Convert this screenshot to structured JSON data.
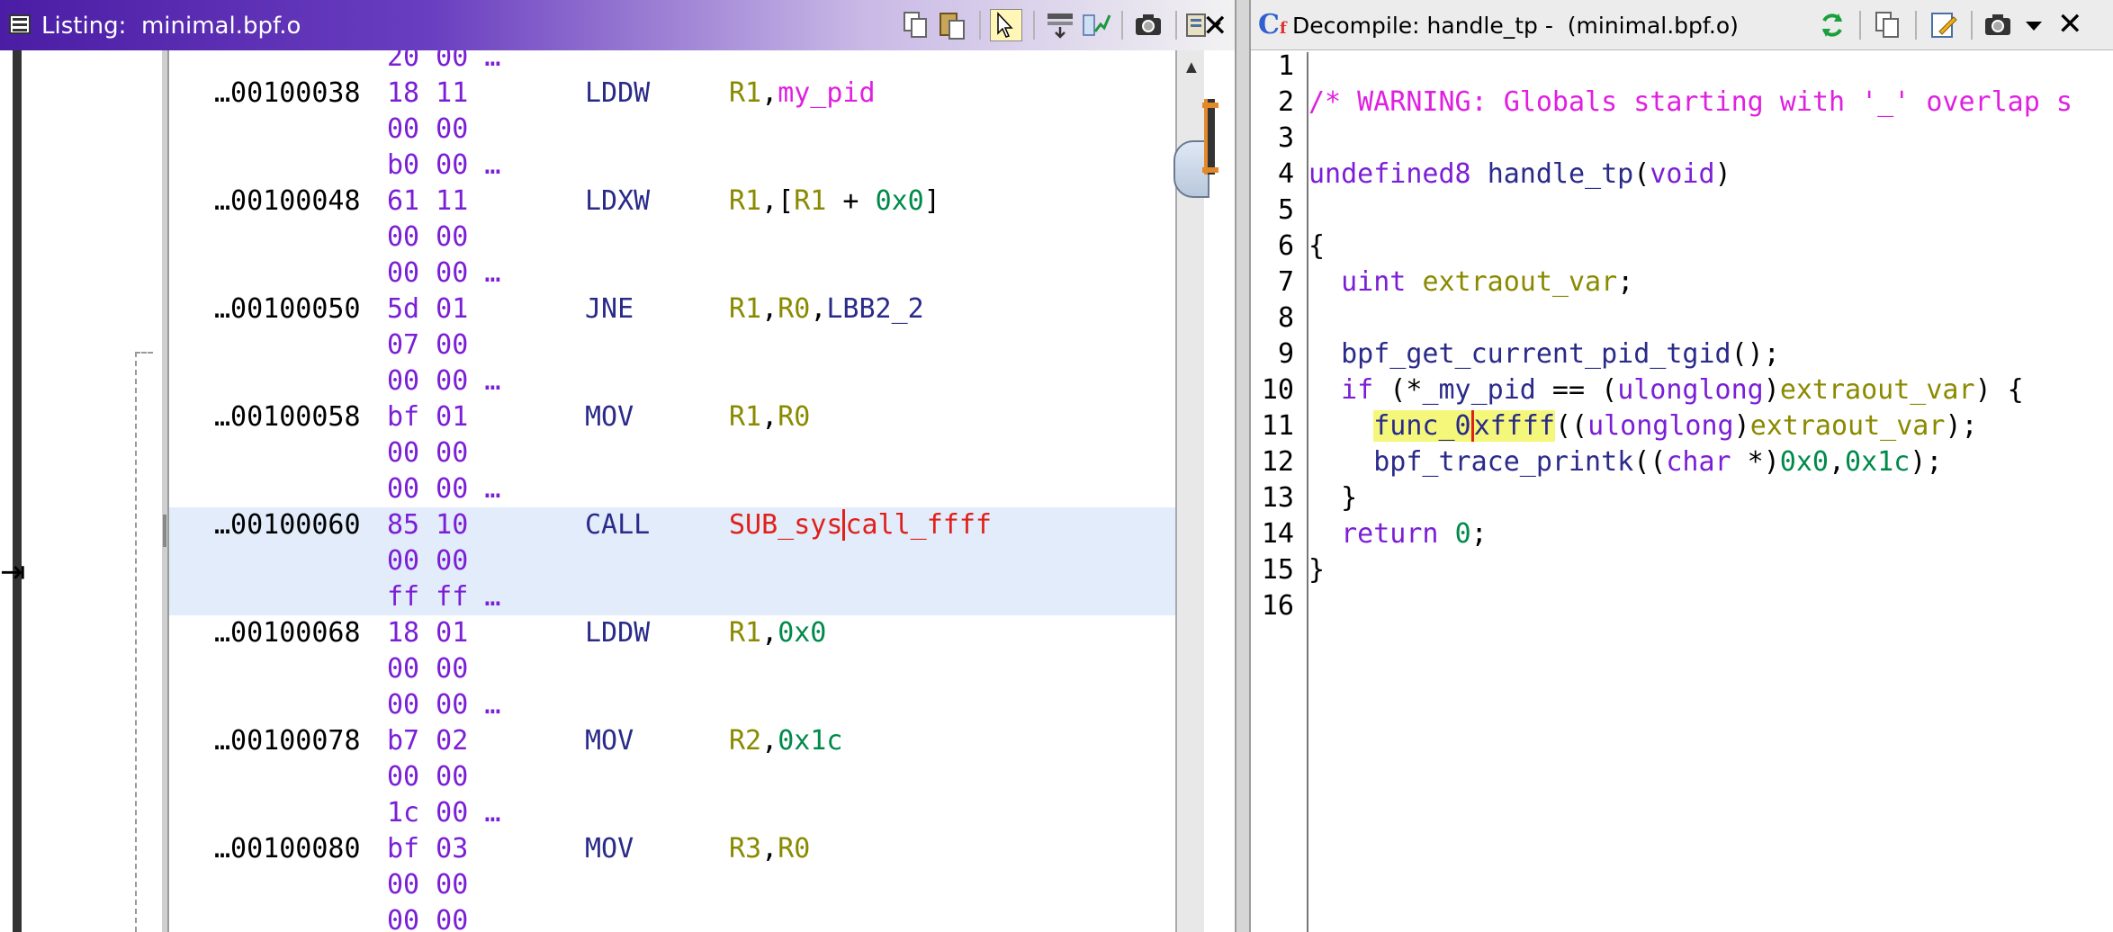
{
  "listing": {
    "title": "Listing:  minimal.bpf.o",
    "rows": [
      {
        "addr": "",
        "bytes": "20 00 …",
        "mnem": "",
        "ops": []
      },
      {
        "addr": "…00100038",
        "bytes": "18 11",
        "mnem": "LDDW",
        "ops": [
          [
            "r",
            "R1"
          ],
          [
            "pun",
            ","
          ],
          [
            "sym",
            "my_pid"
          ]
        ]
      },
      {
        "addr": "",
        "bytes": "00 00",
        "mnem": "",
        "ops": []
      },
      {
        "addr": "",
        "bytes": "b0 00 …",
        "mnem": "",
        "ops": []
      },
      {
        "addr": "…00100048",
        "bytes": "61 11",
        "mnem": "LDXW",
        "ops": [
          [
            "r",
            "R1"
          ],
          [
            "pun",
            ",["
          ],
          [
            "r",
            "R1"
          ],
          [
            "pun",
            " + "
          ],
          [
            "num",
            "0x0"
          ],
          [
            "pun",
            "]"
          ]
        ]
      },
      {
        "addr": "",
        "bytes": "00 00",
        "mnem": "",
        "ops": []
      },
      {
        "addr": "",
        "bytes": "00 00 …",
        "mnem": "",
        "ops": []
      },
      {
        "addr": "…00100050",
        "bytes": "5d 01",
        "mnem": "JNE",
        "ops": [
          [
            "r",
            "R1"
          ],
          [
            "pun",
            ","
          ],
          [
            "r",
            "R0"
          ],
          [
            "pun",
            ","
          ],
          [
            "lbl",
            "LBB2_2"
          ]
        ]
      },
      {
        "addr": "",
        "bytes": "07 00",
        "mnem": "",
        "ops": []
      },
      {
        "addr": "",
        "bytes": "00 00 …",
        "mnem": "",
        "ops": []
      },
      {
        "addr": "…00100058",
        "bytes": "bf 01",
        "mnem": "MOV",
        "ops": [
          [
            "r",
            "R1"
          ],
          [
            "pun",
            ","
          ],
          [
            "r",
            "R0"
          ]
        ]
      },
      {
        "addr": "",
        "bytes": "00 00",
        "mnem": "",
        "ops": []
      },
      {
        "addr": "",
        "bytes": "00 00 …",
        "mnem": "",
        "ops": []
      },
      {
        "addr": "…00100060",
        "bytes": "85 10",
        "mnem": "CALL",
        "ops": [
          [
            "fn",
            "SUB_sys"
          ],
          [
            "fncur",
            "call_ffff"
          ]
        ],
        "highlight": true
      },
      {
        "addr": "",
        "bytes": "00 00",
        "mnem": "",
        "ops": [],
        "highlight": true
      },
      {
        "addr": "",
        "bytes": "ff ff …",
        "mnem": "",
        "ops": [],
        "highlight": true
      },
      {
        "addr": "…00100068",
        "bytes": "18 01",
        "mnem": "LDDW",
        "ops": [
          [
            "r",
            "R1"
          ],
          [
            "pun",
            ","
          ],
          [
            "num",
            "0x0"
          ]
        ]
      },
      {
        "addr": "",
        "bytes": "00 00",
        "mnem": "",
        "ops": []
      },
      {
        "addr": "",
        "bytes": "00 00 …",
        "mnem": "",
        "ops": []
      },
      {
        "addr": "…00100078",
        "bytes": "b7 02",
        "mnem": "MOV",
        "ops": [
          [
            "r",
            "R2"
          ],
          [
            "pun",
            ","
          ],
          [
            "num",
            "0x1c"
          ]
        ]
      },
      {
        "addr": "",
        "bytes": "00 00",
        "mnem": "",
        "ops": []
      },
      {
        "addr": "",
        "bytes": "1c 00 …",
        "mnem": "",
        "ops": []
      },
      {
        "addr": "…00100080",
        "bytes": "bf 03",
        "mnem": "MOV",
        "ops": [
          [
            "r",
            "R3"
          ],
          [
            "pun",
            ","
          ],
          [
            "r",
            "R0"
          ]
        ]
      },
      {
        "addr": "",
        "bytes": "00 00",
        "mnem": "",
        "ops": []
      },
      {
        "addr": "",
        "bytes": "00 00",
        "mnem": "",
        "ops": []
      }
    ]
  },
  "decompile": {
    "title": "Decompile: handle_tp -  (minimal.bpf.o)",
    "lines": [
      {
        "n": "1",
        "tokens": []
      },
      {
        "n": "2",
        "tokens": [
          [
            "cmt",
            "/* WARNING: Globals starting with '_' overlap s"
          ]
        ]
      },
      {
        "n": "3",
        "tokens": []
      },
      {
        "n": "4",
        "tokens": [
          [
            "typ",
            "undefined8"
          ],
          [
            "pun",
            " "
          ],
          [
            "fnm",
            "handle_tp"
          ],
          [
            "pun",
            "("
          ],
          [
            "typ",
            "void"
          ],
          [
            "pun",
            ")"
          ]
        ]
      },
      {
        "n": "5",
        "tokens": []
      },
      {
        "n": "6",
        "tokens": [
          [
            "pun",
            "{"
          ]
        ]
      },
      {
        "n": "7",
        "tokens": [
          [
            "pun",
            "  "
          ],
          [
            "typ",
            "uint"
          ],
          [
            "pun",
            " "
          ],
          [
            "var",
            "extraout_var"
          ],
          [
            "pun",
            ";"
          ]
        ]
      },
      {
        "n": "8",
        "tokens": []
      },
      {
        "n": "9",
        "tokens": [
          [
            "pun",
            "  "
          ],
          [
            "fnm",
            "bpf_get_current_pid_tgid"
          ],
          [
            "pun",
            "();"
          ]
        ]
      },
      {
        "n": "10",
        "tokens": [
          [
            "pun",
            "  "
          ],
          [
            "kw",
            "if"
          ],
          [
            "pun",
            " (*"
          ],
          [
            "glb",
            "_my_pid"
          ],
          [
            "pun",
            " == ("
          ],
          [
            "typ",
            "ulonglong"
          ],
          [
            "pun",
            ")"
          ],
          [
            "var",
            "extraout_var"
          ],
          [
            "pun",
            ") {"
          ]
        ]
      },
      {
        "n": "11",
        "tokens": [
          [
            "pun",
            "    "
          ],
          [
            "hl",
            "func_0"
          ],
          [
            "hlc",
            "xffff"
          ],
          [
            "pun",
            "(("
          ],
          [
            "typ",
            "ulonglong"
          ],
          [
            "pun",
            ")"
          ],
          [
            "var",
            "extraout_var"
          ],
          [
            "pun",
            ");"
          ]
        ]
      },
      {
        "n": "12",
        "tokens": [
          [
            "pun",
            "    "
          ],
          [
            "fnm",
            "bpf_trace_printk"
          ],
          [
            "pun",
            "(("
          ],
          [
            "typ",
            "char"
          ],
          [
            "pun",
            " *)"
          ],
          [
            "cn",
            "0x0"
          ],
          [
            "pun",
            ","
          ],
          [
            "cn",
            "0x1c"
          ],
          [
            "pun",
            ");"
          ]
        ]
      },
      {
        "n": "13",
        "tokens": [
          [
            "pun",
            "  }"
          ]
        ]
      },
      {
        "n": "14",
        "tokens": [
          [
            "pun",
            "  "
          ],
          [
            "kw",
            "return"
          ],
          [
            "pun",
            " "
          ],
          [
            "cn",
            "0"
          ],
          [
            "pun",
            ";"
          ]
        ]
      },
      {
        "n": "15",
        "tokens": [
          [
            "pun",
            "}"
          ]
        ]
      },
      {
        "n": "16",
        "tokens": []
      }
    ]
  },
  "icons": [
    "listing-window-icon",
    "copy-icon",
    "paste-icon",
    "select-cursor-icon",
    "field-layout-icon",
    "diff-view-icon",
    "snapshot-icon",
    "options-menu-icon",
    "close-icon",
    "refresh-icon",
    "decompile-copy-icon",
    "edit-icon",
    "decompile-snapshot-icon",
    "dropdown-icon"
  ]
}
